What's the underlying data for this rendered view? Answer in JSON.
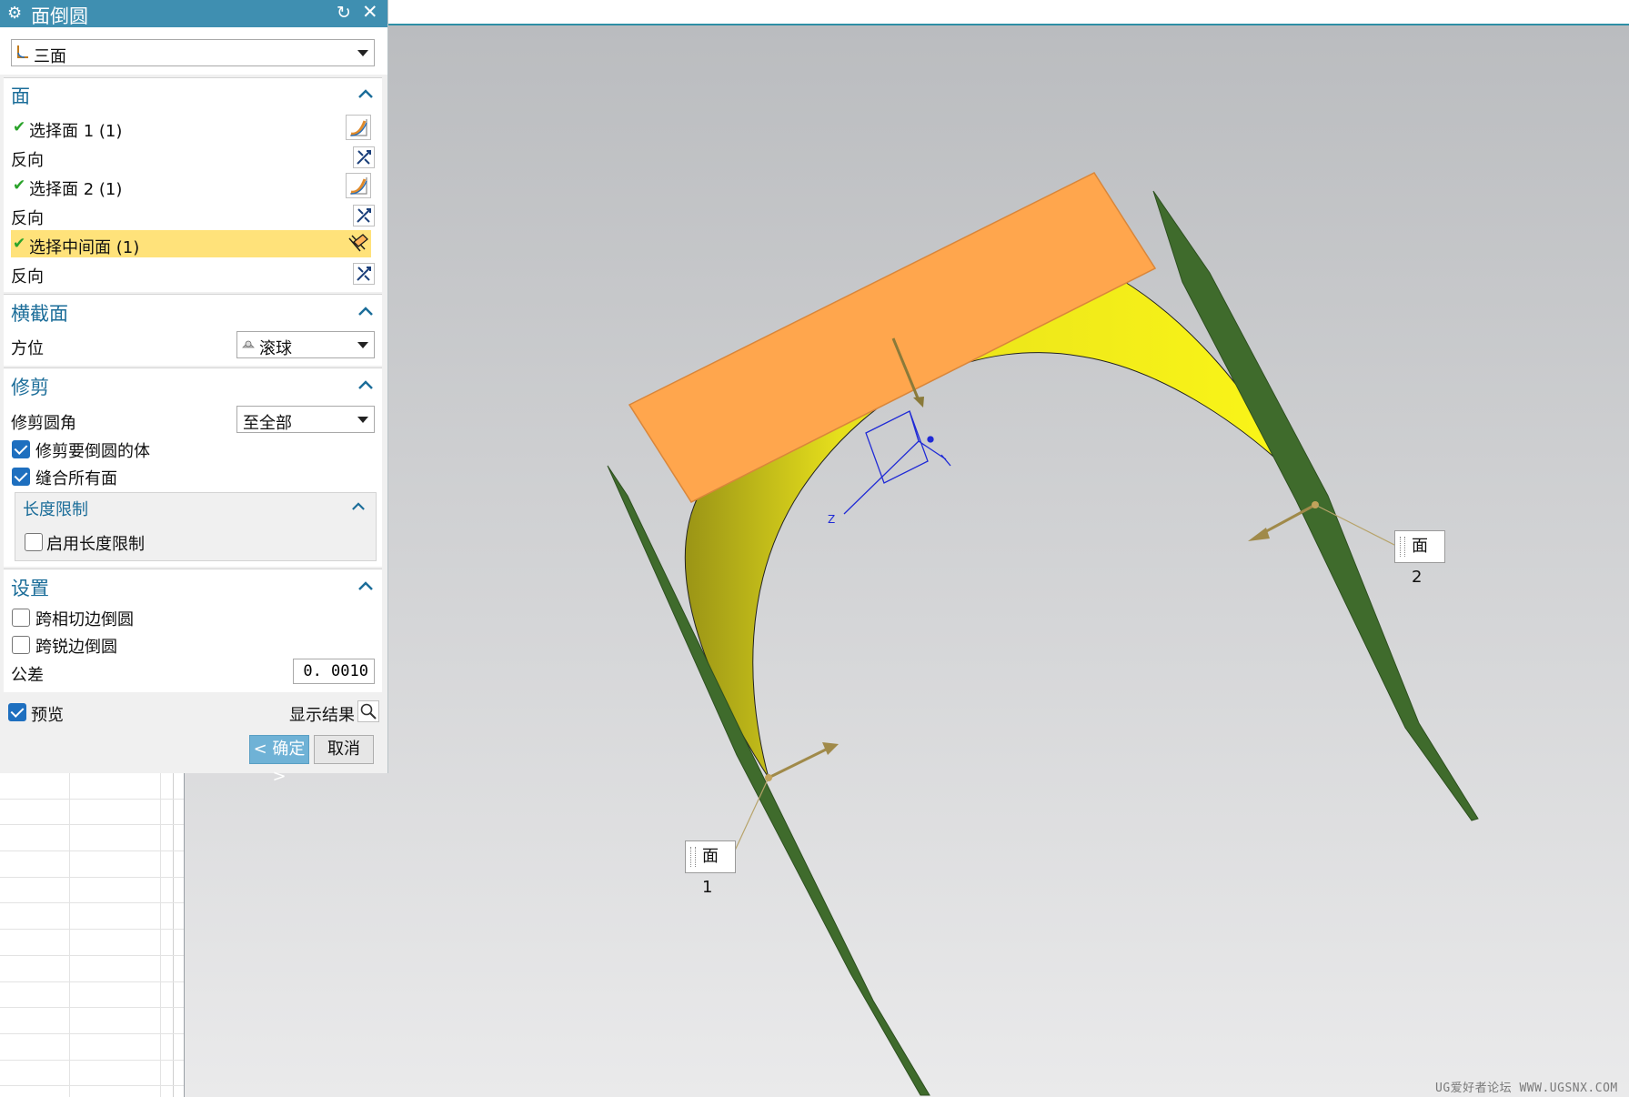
{
  "dialog": {
    "title": "面倒圆",
    "type_combo": {
      "value": "三面"
    },
    "faces_section": {
      "header": "面",
      "rows": [
        {
          "label": "选择面 1 (1)",
          "selected": true
        },
        {
          "label": "反向"
        },
        {
          "label": "选择面 2 (1)",
          "selected": true
        },
        {
          "label": "反向"
        },
        {
          "label": "选择中间面 (1)",
          "selected": true,
          "active": true
        },
        {
          "label": "反向"
        }
      ]
    },
    "cross_section": {
      "header": "横截面",
      "orientation_label": "方位",
      "orientation_value": "滚球"
    },
    "trim_section": {
      "header": "修剪",
      "trim_label": "修剪圆角",
      "trim_value": "至全部",
      "trim_body_label": "修剪要倒圆的体",
      "trim_body_checked": true,
      "sew_label": "缝合所有面",
      "sew_checked": true,
      "length_limit": {
        "header": "长度限制",
        "enable_label": "启用长度限制",
        "enable_checked": false
      }
    },
    "settings_section": {
      "header": "设置",
      "tangent_label": "跨相切边倒圆",
      "tangent_checked": false,
      "sharp_label": "跨锐边倒圆",
      "sharp_checked": false,
      "tolerance_label": "公差",
      "tolerance_value": "0. 0010"
    },
    "preview_label": "预览",
    "preview_checked": true,
    "show_result_label": "显示结果",
    "ok_label": "< 确定 >",
    "cancel_label": "取消"
  },
  "viewport": {
    "callout_face1": "面 1",
    "callout_face2": "面 2",
    "axis_label": "Z",
    "watermark": "UG爱好者论坛 WWW.UGSNX.COM"
  },
  "colors": {
    "title_bar": "#3f8fb1",
    "section_header": "#1b6d99",
    "highlight_row": "#ffe27a",
    "green_face": "#3f6b2c",
    "blend_surface": "#f4f01a",
    "middle_face": "#ffa64d",
    "check_green": "#2aa32a",
    "ok_button": "#6fb2d6"
  }
}
